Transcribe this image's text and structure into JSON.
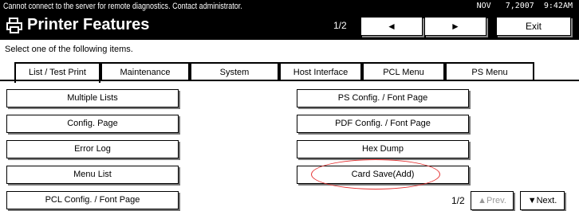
{
  "status": {
    "message": "Cannot connect to the server for remote diagnostics. Contact administrator.",
    "datetime": "NOV   7,2007  9:42AM"
  },
  "header": {
    "title": "Printer Features",
    "page": "1/2",
    "prev_arrow": "◄",
    "next_arrow": "►",
    "exit_label": "Exit"
  },
  "instruction": "Select one of the following items.",
  "tabs": [
    {
      "label": "List / Test Print",
      "active": true
    },
    {
      "label": "Maintenance"
    },
    {
      "label": "System"
    },
    {
      "label": "Host Interface"
    },
    {
      "label": "PCL Menu"
    },
    {
      "label": "PS Menu"
    }
  ],
  "items_left": [
    "Multiple Lists",
    "Config. Page",
    "Error Log",
    "Menu List",
    "PCL Config. / Font Page"
  ],
  "items_right": [
    "PS Config. / Font Page",
    "PDF Config. / Font Page",
    "Hex Dump",
    "Card Save(Add)"
  ],
  "pager": {
    "page": "1/2",
    "prev_label": "▲Prev.",
    "next_label": "▼Next."
  },
  "colors": {
    "highlight": "#e53030"
  }
}
